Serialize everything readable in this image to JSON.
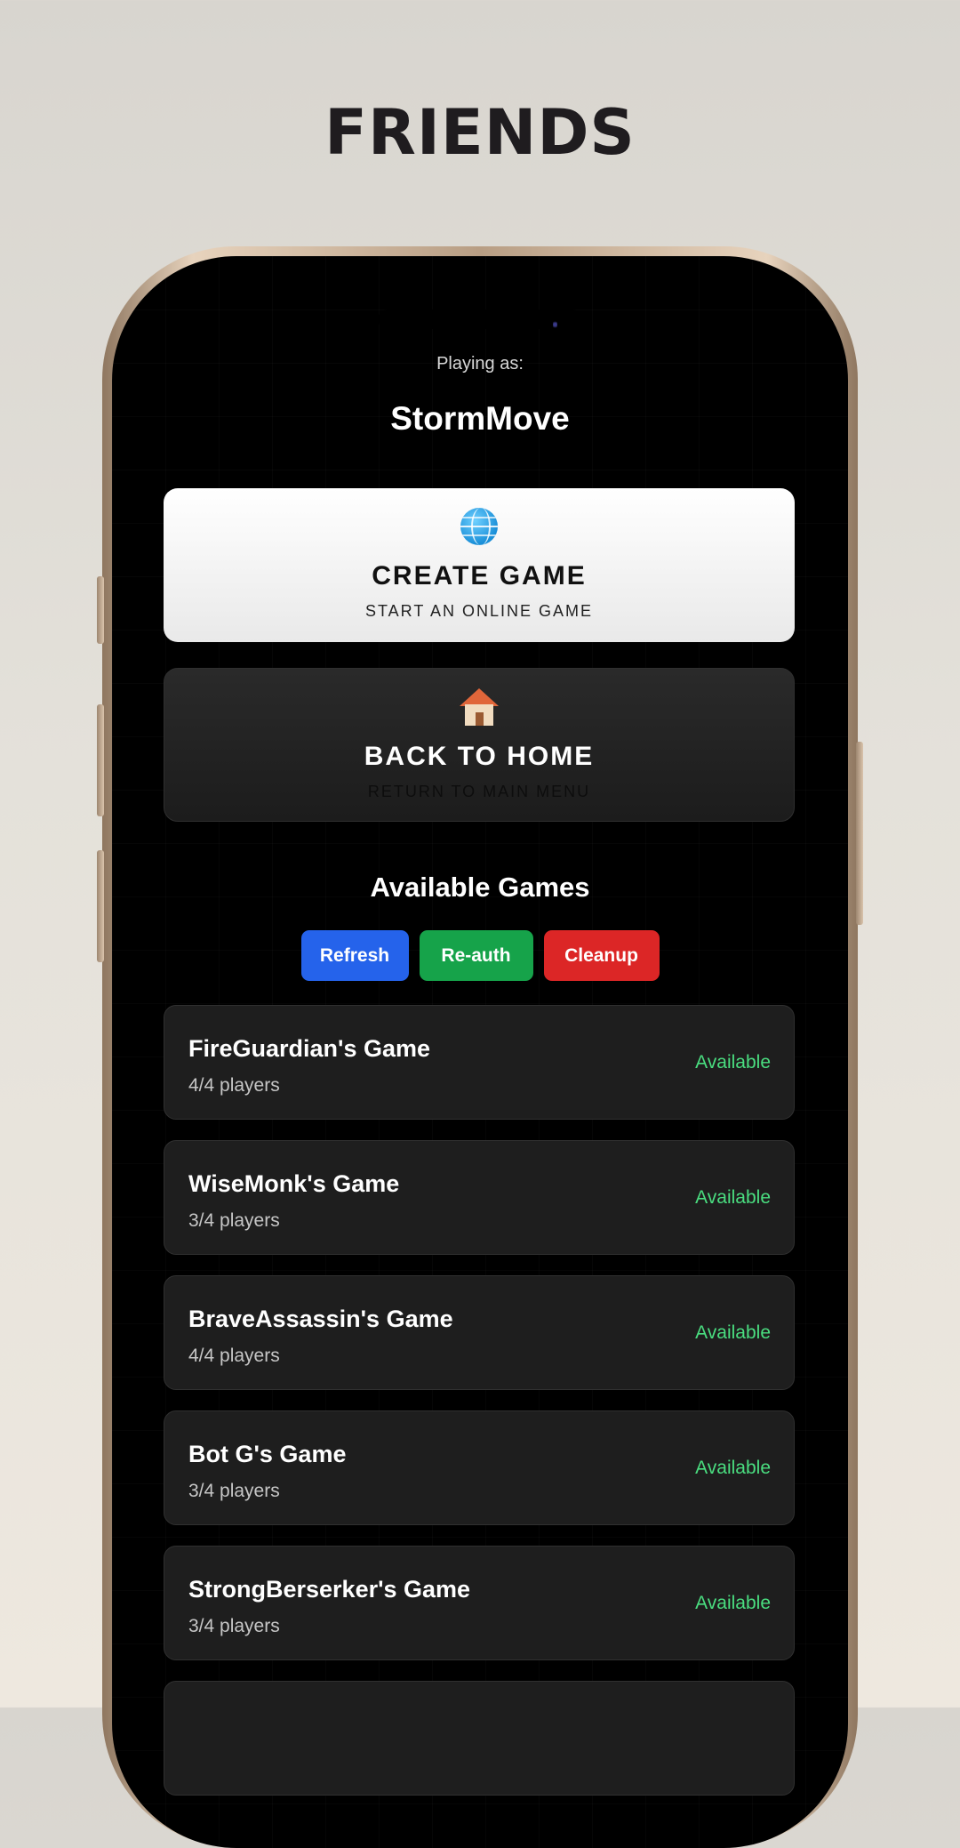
{
  "page_title": "FRIENDS",
  "player": {
    "label": "Playing as:",
    "name": "StormMove"
  },
  "create_card": {
    "icon": "globe-icon",
    "title": "CREATE GAME",
    "subtitle": "START AN ONLINE GAME"
  },
  "home_card": {
    "icon": "house-icon",
    "title": "BACK TO HOME",
    "subtitle": "RETURN TO MAIN MENU"
  },
  "games_section": {
    "heading": "Available Games",
    "buttons": {
      "refresh": "Refresh",
      "reauth": "Re-auth",
      "cleanup": "Cleanup"
    },
    "games": [
      {
        "name": "FireGuardian's Game",
        "players": "4/4 players",
        "status": "Available"
      },
      {
        "name": "WiseMonk's Game",
        "players": "3/4 players",
        "status": "Available"
      },
      {
        "name": "BraveAssassin's Game",
        "players": "4/4 players",
        "status": "Available"
      },
      {
        "name": "Bot G's Game",
        "players": "3/4 players",
        "status": "Available"
      },
      {
        "name": "StrongBerserker's Game",
        "players": "3/4 players",
        "status": "Available"
      }
    ]
  },
  "colors": {
    "refresh_button": "#2563eb",
    "reauth_button": "#16a34a",
    "cleanup_button": "#dc2626",
    "status_available": "#4ade80",
    "screen_background": "#000000",
    "page_background": "#d8d5cf"
  }
}
